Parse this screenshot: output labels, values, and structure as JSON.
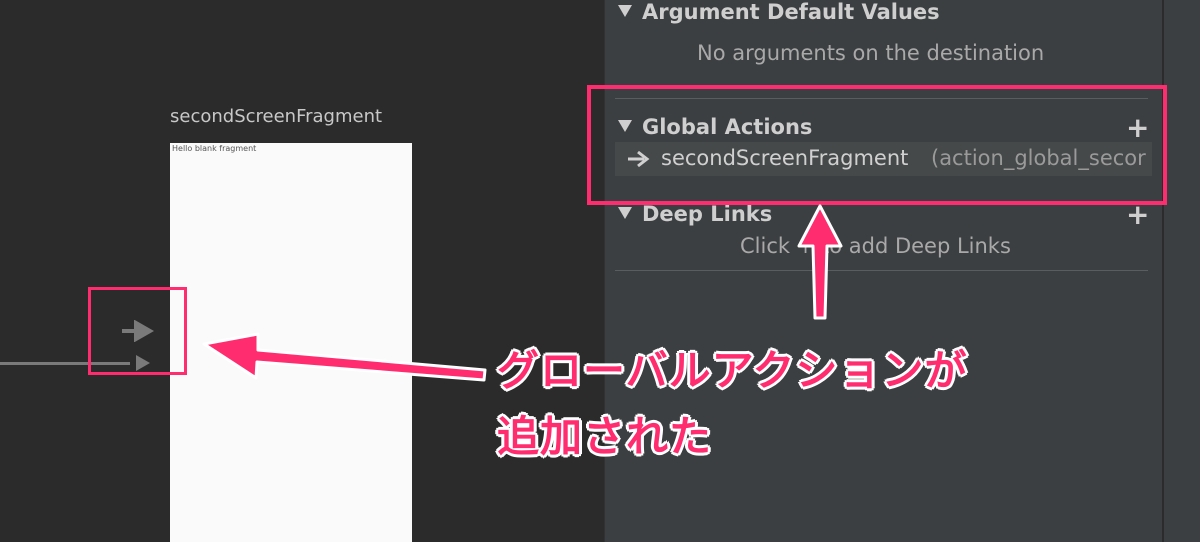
{
  "canvas": {
    "fragment_title": "secondScreenFragment",
    "fragment_preview_text": "Hello blank fragment"
  },
  "panel": {
    "argument_defaults": {
      "header": "Argument Default Values",
      "empty_text": "No arguments on the destination"
    },
    "global_actions": {
      "header": "Global Actions",
      "add_label": "+",
      "items": [
        {
          "destination": "secondScreenFragment",
          "action_id": "(action_global_secor"
        }
      ]
    },
    "deep_links": {
      "header": "Deep Links",
      "add_label": "+",
      "empty_text": "Click + to add Deep Links"
    }
  },
  "annotation": {
    "line1": "グローバルアクションが",
    "line2": "追加された",
    "color": "#ff2d6f"
  },
  "icons": {
    "collapse": "triangle-down-icon",
    "action": "arrow-right-icon",
    "add": "plus-icon"
  }
}
